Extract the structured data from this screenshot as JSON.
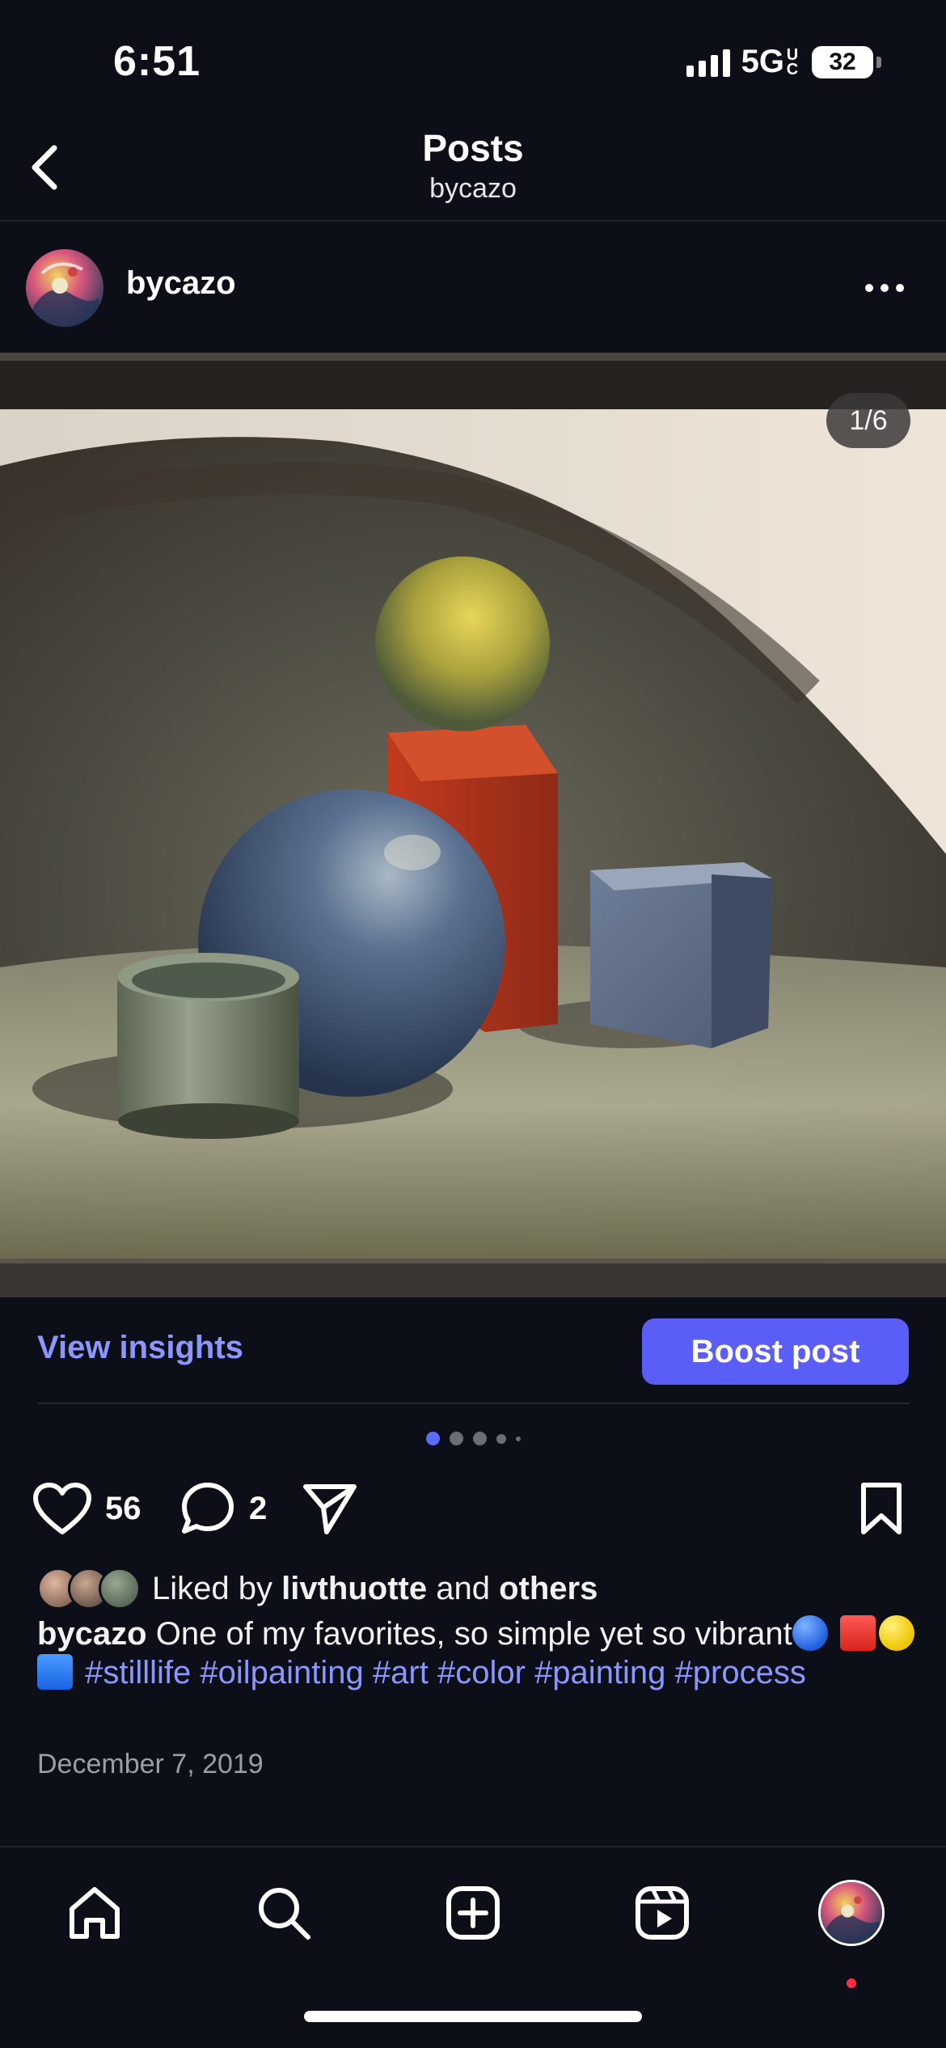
{
  "status_bar": {
    "time": "6:51",
    "network": "5G",
    "network_suffix_top": "U",
    "network_suffix_bottom": "C",
    "battery": "32"
  },
  "header": {
    "title": "Posts",
    "subtitle": "bycazo",
    "back_icon": "chevron-left-icon"
  },
  "post": {
    "username": "bycazo",
    "more_icon": "ellipsis-icon",
    "image_counter": "1/6",
    "view_insights_label": "View insights",
    "boost_label": "Boost post",
    "carousel": {
      "total": 6,
      "active_index": 0
    },
    "likes_count": "56",
    "comments_count": "2",
    "liked_by_prefix": "Liked by",
    "liked_by_user": "livthuotte",
    "liked_by_and": "and",
    "liked_by_others": "others",
    "caption_user": "bycazo",
    "caption_text": "One of my favorites, so simple yet so vibrant",
    "caption_emojis": [
      "blue-circle",
      "red-square",
      "yellow-circle",
      "blue-square"
    ],
    "hashtags": [
      "#stilllife",
      "#oilpainting",
      "#art",
      "#color",
      "#painting",
      "#process"
    ],
    "date": "December 7, 2019"
  },
  "colors": {
    "background": "#0c0f18",
    "link": "#8b96ff",
    "boost_button": "#5b5ef6",
    "notification_dot": "#ff2d46"
  },
  "bottom_nav": {
    "items": [
      "home-icon",
      "search-icon",
      "create-icon",
      "reels-icon",
      "profile-avatar"
    ]
  }
}
